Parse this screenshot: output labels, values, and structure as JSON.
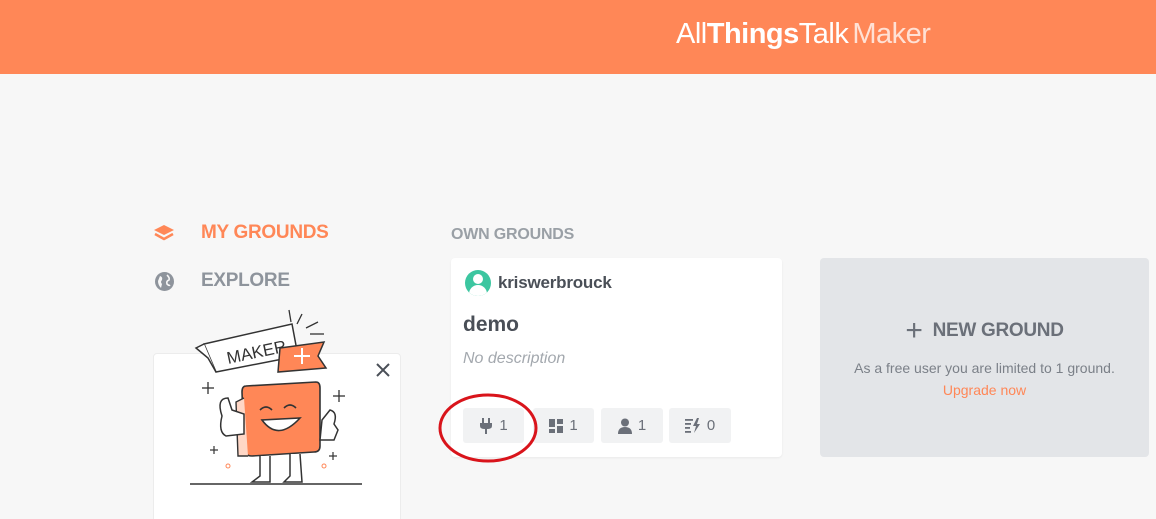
{
  "header": {
    "logo_parts": [
      "All",
      "Things",
      "Talk",
      "Maker"
    ],
    "brand_color": "#ff8757"
  },
  "nav": {
    "items": [
      {
        "label": "MY GROUNDS",
        "icon": "layers-icon",
        "active": true
      },
      {
        "label": "EXPLORE",
        "icon": "globe-icon",
        "active": false
      }
    ]
  },
  "promo": {
    "banner_text": "MAKER",
    "close_icon": "close-icon"
  },
  "own_grounds": {
    "section_title": "OWN GROUNDS",
    "card": {
      "owner": "kriswerbrouck",
      "name": "demo",
      "description": "No description",
      "stats": {
        "devices": "1",
        "pinboards": "1",
        "members": "1",
        "rules": "0"
      }
    }
  },
  "new_ground": {
    "title": "NEW GROUND",
    "note": "As a free user you are limited to 1 ground.",
    "upgrade_label": "Upgrade now"
  },
  "colors": {
    "accent": "#ff8757",
    "annotation": "#d9141b",
    "avatar": "#3cc6a0"
  }
}
